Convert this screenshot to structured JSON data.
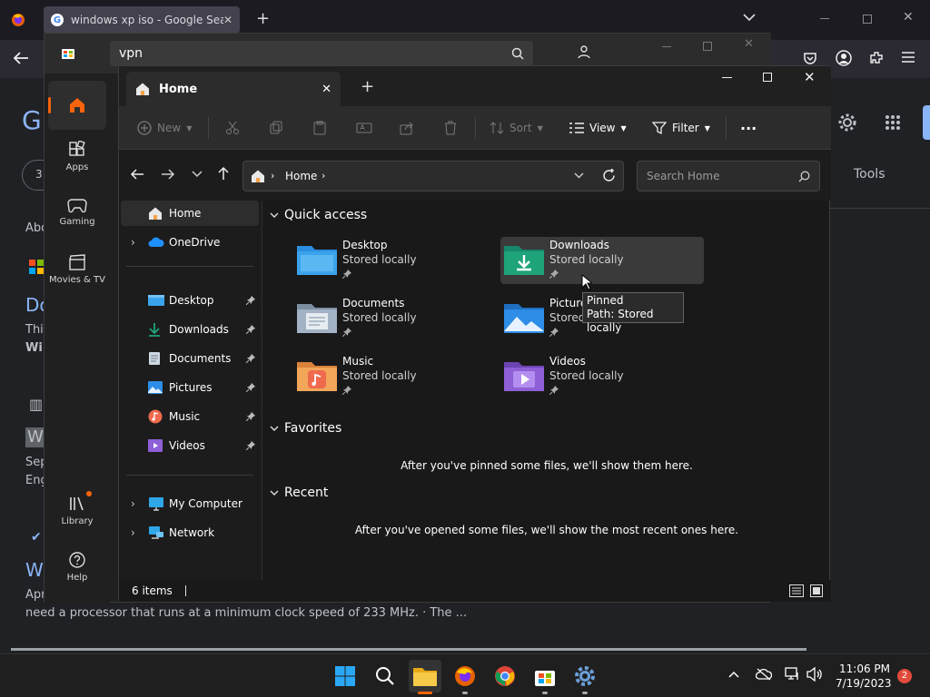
{
  "firefox": {
    "tab_title": "windows xp iso - Google Search",
    "new_tab": "+",
    "tools_label": "Tools"
  },
  "google": {
    "logo_letter": "G",
    "result_count_prefix": "3",
    "about": "Abo",
    "result1_title": "Do",
    "result1_snip1": "Thi",
    "result1_snip2": "Wi",
    "result2_badge": "W",
    "result2_snip1": "Sep",
    "result2_snip2": "Eng",
    "result3_title": "W",
    "result3_snip1": "Apr",
    "bottom_snippet": "need a processor that runs at a minimum clock speed of 233 MHz. · The ..."
  },
  "store": {
    "search_value": "vpn",
    "rail": {
      "apps": "Apps",
      "gaming": "Gaming",
      "movies": "Movies & TV",
      "library": "Library",
      "help": "Help"
    }
  },
  "explorer": {
    "tab_title": "Home",
    "toolbar": {
      "new": "New",
      "sort": "Sort",
      "view": "View",
      "filter": "Filter",
      "more": "···"
    },
    "breadcrumb": "Home",
    "search_placeholder": "Search Home",
    "nav": {
      "home": "Home",
      "onedrive": "OneDrive",
      "desktop": "Desktop",
      "downloads": "Downloads",
      "documents": "Documents",
      "pictures": "Pictures",
      "music": "Music",
      "videos": "Videos",
      "my_computer": "My Computer",
      "network": "Network"
    },
    "sections": {
      "quick_access": "Quick access",
      "favorites": "Favorites",
      "recent": "Recent"
    },
    "tiles": [
      {
        "name": "Desktop",
        "status": "Stored locally"
      },
      {
        "name": "Downloads",
        "status": "Stored locally"
      },
      {
        "name": "Documents",
        "status": "Stored locally"
      },
      {
        "name": "Pictures",
        "status": "Stored locally"
      },
      {
        "name": "Music",
        "status": "Stored locally"
      },
      {
        "name": "Videos",
        "status": "Stored locally"
      }
    ],
    "favorites_empty": "After you've pinned some files, we'll show them here.",
    "recent_empty": "After you've opened some files, we'll show the most recent ones here.",
    "status_items": "6 items",
    "tooltip_line1": "Pinned",
    "tooltip_line2": "Path: Stored locally"
  },
  "taskbar": {
    "time": "11:06 PM",
    "date": "7/19/2023",
    "notification_count": "2"
  },
  "colors": {
    "accent_orange": "#f7630c",
    "folder_blue": "#3ba3ec",
    "download_green": "#1fa37a"
  }
}
